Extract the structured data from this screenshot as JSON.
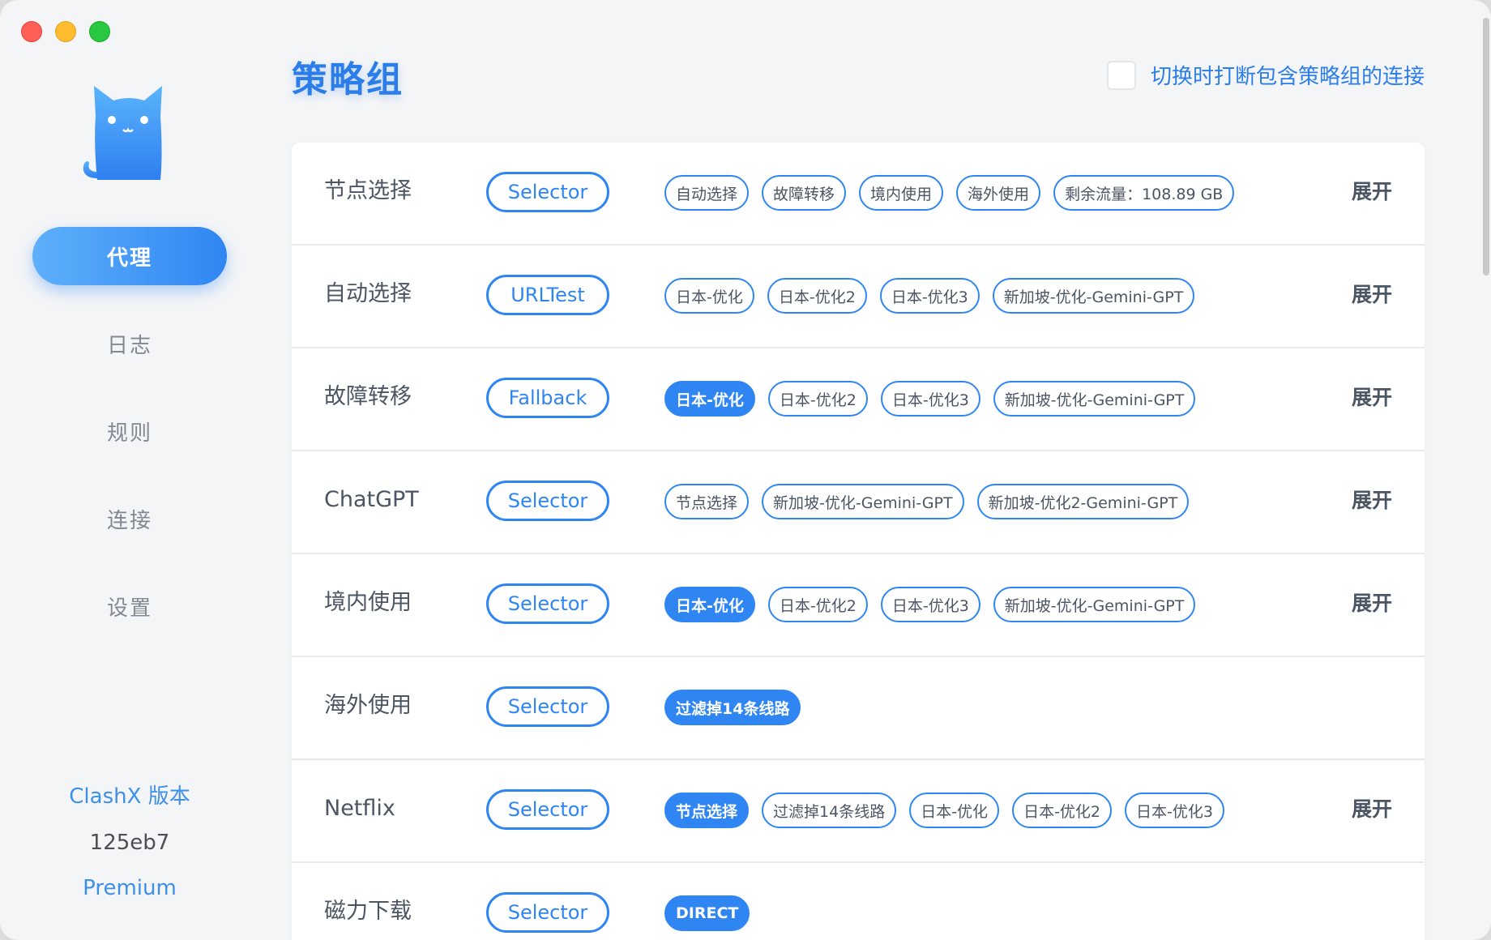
{
  "sidebar": {
    "logo": "cat-icon",
    "items": [
      {
        "label": "代理",
        "active": true
      },
      {
        "label": "日志",
        "active": false
      },
      {
        "label": "规则",
        "active": false
      },
      {
        "label": "连接",
        "active": false
      },
      {
        "label": "设置",
        "active": false
      }
    ],
    "version_title": "ClashX 版本",
    "version_hash": "125eb7",
    "version_edition": "Premium"
  },
  "header": {
    "title": "策略组",
    "interrupt_label": "切换时打断包含策略组的连接",
    "interrupt_checked": false
  },
  "expand_label": "展开",
  "groups": [
    {
      "name": "节点选择",
      "type": "Selector",
      "show_expand": true,
      "tags": [
        {
          "label": "自动选择",
          "selected": false
        },
        {
          "label": "故障转移",
          "selected": false
        },
        {
          "label": "境内使用",
          "selected": false
        },
        {
          "label": "海外使用",
          "selected": false
        },
        {
          "label": "剩余流量：108.89 GB",
          "selected": false
        }
      ]
    },
    {
      "name": "自动选择",
      "type": "URLTest",
      "show_expand": true,
      "tags": [
        {
          "label": "日本-优化",
          "selected": false
        },
        {
          "label": "日本-优化2",
          "selected": false
        },
        {
          "label": "日本-优化3",
          "selected": false
        },
        {
          "label": "新加坡-优化-Gemini-GPT",
          "selected": false
        }
      ]
    },
    {
      "name": "故障转移",
      "type": "Fallback",
      "show_expand": true,
      "tags": [
        {
          "label": "日本-优化",
          "selected": true
        },
        {
          "label": "日本-优化2",
          "selected": false
        },
        {
          "label": "日本-优化3",
          "selected": false
        },
        {
          "label": "新加坡-优化-Gemini-GPT",
          "selected": false
        }
      ]
    },
    {
      "name": "ChatGPT",
      "type": "Selector",
      "show_expand": true,
      "tags": [
        {
          "label": "节点选择",
          "selected": false
        },
        {
          "label": "新加坡-优化-Gemini-GPT",
          "selected": false
        },
        {
          "label": "新加坡-优化2-Gemini-GPT",
          "selected": false
        }
      ]
    },
    {
      "name": "境内使用",
      "type": "Selector",
      "show_expand": true,
      "tags": [
        {
          "label": "日本-优化",
          "selected": true
        },
        {
          "label": "日本-优化2",
          "selected": false
        },
        {
          "label": "日本-优化3",
          "selected": false
        },
        {
          "label": "新加坡-优化-Gemini-GPT",
          "selected": false
        }
      ]
    },
    {
      "name": "海外使用",
      "type": "Selector",
      "show_expand": false,
      "tags": [
        {
          "label": "过滤掉14条线路",
          "selected": true
        }
      ]
    },
    {
      "name": "Netflix",
      "type": "Selector",
      "show_expand": true,
      "tags": [
        {
          "label": "节点选择",
          "selected": true
        },
        {
          "label": "过滤掉14条线路",
          "selected": false
        },
        {
          "label": "日本-优化",
          "selected": false
        },
        {
          "label": "日本-优化2",
          "selected": false
        },
        {
          "label": "日本-优化3",
          "selected": false
        }
      ]
    },
    {
      "name": "磁力下载",
      "type": "Selector",
      "show_expand": false,
      "tags": [
        {
          "label": "DIRECT",
          "selected": true
        }
      ]
    }
  ]
}
